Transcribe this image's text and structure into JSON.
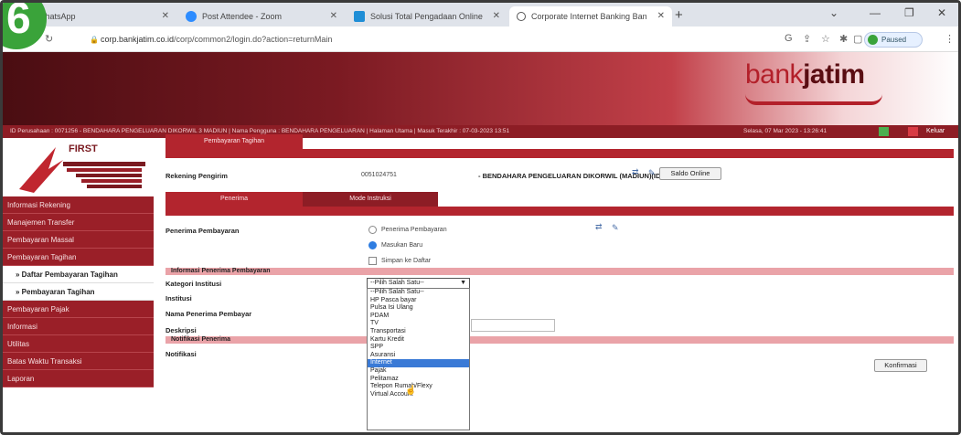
{
  "browser": {
    "tabs": [
      {
        "label": "WhatsApp",
        "icon": "whatsapp-icon"
      },
      {
        "label": "Post Attendee - Zoom",
        "icon": "zoom-icon"
      },
      {
        "label": "Solusi Total Pengadaan Online",
        "icon": "site-icon"
      },
      {
        "label": "Corporate Internet Banking Ban",
        "icon": "globe-icon"
      }
    ],
    "url_host": "corp.bankjatim.co.id",
    "url_path": "/corp/common2/login.do?action=returnMain",
    "profile_status": "Paused"
  },
  "step_badge": "6",
  "brand": {
    "logo_part1": "bank",
    "logo_part2": "jatim"
  },
  "infobar": {
    "left": "ID Perusahaan : 0071256 - BENDAHARA PENGELUARAN DIKORWIL 3 MADIUN | Nama Pengguna : BENDAHARA PENGELUARAN | Halaman Utama | Masuk Terakhir : 07-03-2023 13:51",
    "right": "Selasa, 07 Mar 2023 - 13:26:41",
    "logout": "Keluar"
  },
  "sidebar": {
    "first_label": "FIRST",
    "items": [
      {
        "label": "Informasi Rekening",
        "sub": false
      },
      {
        "label": "Manajemen Transfer",
        "sub": false
      },
      {
        "label": "Pembayaran Massal",
        "sub": false
      },
      {
        "label": "Pembayaran Tagihan",
        "sub": false
      },
      {
        "label": "» Daftar Pembayaran Tagihan",
        "sub": true
      },
      {
        "label": "» Pembayaran Tagihan",
        "sub": true
      },
      {
        "label": "Pembayaran Pajak",
        "sub": false
      },
      {
        "label": "Informasi",
        "sub": false
      },
      {
        "label": "Utilitas",
        "sub": false
      },
      {
        "label": "Batas Waktu Transaksi",
        "sub": false
      },
      {
        "label": "Laporan",
        "sub": false
      }
    ]
  },
  "main": {
    "page_tab": "Pembayaran Tagihan",
    "rekening_label": "Rekening Pengirim",
    "rekening_value": "0051024751",
    "rekening_name": "- BENDAHARA PENGELUARAN DIKORWIL (MADIUN)(IDR)",
    "saldo_button": "Saldo Online",
    "tab_penerima": "Penerima",
    "tab_mode": "Mode Instruksi",
    "penerima_label": "Penerima Pembayaran",
    "radio_penerima": "Penerima Pembayaran",
    "radio_masukan": "Masukan Baru",
    "checkbox_simpan": "Simpan ke Daftar",
    "section_info": "Informasi Penerima Pembayaran",
    "kategori_label": "Kategori Institusi",
    "kategori_value": "--Pilih Salah Satu--",
    "institusi_label": "Institusi",
    "nama_label": "Nama Penerima Pembayar",
    "deskripsi_label": "Deskripsi",
    "section_notif": "Notifikasi Penerima",
    "notifikasi_label": "Notifikasi",
    "konfirmasi_button": "Konfirmasi"
  },
  "dropdown": {
    "options": [
      "--Pilih Salah Satu--",
      "HP Pasca bayar",
      "Pulsa Isi Ulang",
      "PDAM",
      "TV",
      "Transportasi",
      "Kartu Kredit",
      "SPP",
      "Asuransi",
      "Internet",
      "Pajak",
      "Pelitamaz",
      "Telepon Rumah/Flexy",
      "Virtual Account"
    ],
    "highlighted_index": 9
  }
}
